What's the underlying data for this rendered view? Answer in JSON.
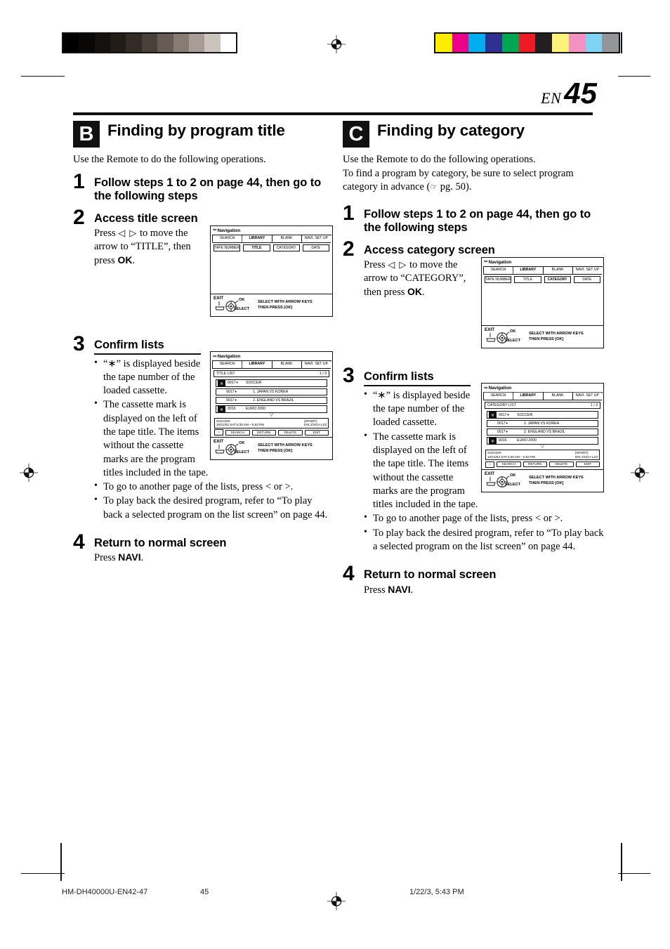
{
  "page": {
    "locale_label": "EN",
    "number": "45"
  },
  "printer_marks": {
    "grayscale_steps": [
      "#000000",
      "#090807",
      "#15110f",
      "#221c18",
      "#332b25",
      "#4a403a",
      "#675c55",
      "#877c74",
      "#a79d96",
      "#cbc4bd",
      "#ffffff"
    ],
    "color_steps": [
      "#fdee00",
      "#ec008c",
      "#00aeef",
      "#2e3192",
      "#00a651",
      "#ed1c24",
      "#231f20",
      "#fff27a",
      "#f491c3",
      "#7fd4f4",
      "#939598"
    ]
  },
  "sections": [
    {
      "badge": "B",
      "title": "Finding by program title",
      "lead": "Use the Remote to do the following operations.",
      "lead2": "",
      "steps": [
        {
          "number": "1",
          "title": "Follow steps 1 to 2 on page 44, then go to the following steps",
          "text": ""
        },
        {
          "number": "2",
          "title": "Access title screen",
          "text_pre": "Press ",
          "arrows": "◁ ▷",
          "text_mid": " to move the arrow to “TITLE”, then press ",
          "bold": "OK",
          "text_post": "."
        },
        {
          "number": "3",
          "title": "Confirm lists",
          "bullets": [
            "“∗” is displayed beside the tape number of the loaded cassette.",
            "The cassette mark is displayed on the left of the tape title. The items without the cassette marks are the program titles included in the tape.",
            "To go to another page of the lists, press < or >.",
            "To play back the desired program, refer to “To play back a selected program on the list screen” on page 44."
          ]
        },
        {
          "number": "4",
          "title": "Return to normal screen",
          "text_pre": "Press ",
          "bold": "NAVI",
          "text_post": "."
        }
      ]
    },
    {
      "badge": "C",
      "title": "Finding by category",
      "lead": "Use the Remote to do the following operations.",
      "lead2_pre": "To find a program by category, be sure to select program category in advance (",
      "lead2_hand": "☞",
      "lead2_post": " pg. 50).",
      "steps": [
        {
          "number": "1",
          "title": "Follow steps 1 to 2 on page 44, then go to the following steps",
          "text": ""
        },
        {
          "number": "2",
          "title": "Access category screen",
          "text_pre": "Press ",
          "arrows": "◁ ▷",
          "text_mid": " to move the arrow to “CATEGORY”, then press ",
          "bold": "OK",
          "text_post": "."
        },
        {
          "number": "3",
          "title": "Confirm lists",
          "bullets": [
            "“∗” is displayed beside the tape number of the loaded cassette.",
            "The cassette mark is displayed on the left of the tape title. The items without the cassette marks are the program titles included in the tape.",
            "To go to another page of the lists, press < or >.",
            "To play back the desired program, refer to “To play back a selected program on the list screen” on page 44."
          ]
        },
        {
          "number": "4",
          "title": "Return to normal screen",
          "text_pre": "Press ",
          "bold": "NAVI",
          "text_post": "."
        }
      ]
    }
  ],
  "osd": {
    "navi_label": "Navigation",
    "tabs": [
      "SEARCH",
      "LIBRARY",
      "BLANK",
      "NAVI. SET UP"
    ],
    "selected_tab": "LIBRARY",
    "fields": [
      "TAPE NUMBER",
      "TITLE",
      "CATEGORY",
      "DATE"
    ],
    "footer_exit": "EXIT",
    "footer_ok": "OK",
    "footer_select": "SELECT",
    "footer_msg_line1": "SELECT WITH ARROW KEYS",
    "footer_msg_line2": "THEN PRESS [OK]",
    "list_page": "1 / 3",
    "rows": [
      {
        "mark": "■",
        "num": "0017∗",
        "title": "SOCCER",
        "indent": false,
        "strong": true
      },
      {
        "mark": "",
        "num": "0017∗",
        "title": "1. JAPAN VS KOREA",
        "indent": true,
        "strong": false
      },
      {
        "mark": "",
        "num": "0017∗",
        "title": "2. ENGLAND VS BRAZIL",
        "indent": true,
        "strong": true
      },
      {
        "mark": "■",
        "num": "0016",
        "title": "EURO 2000",
        "indent": false,
        "strong": true
      }
    ],
    "chevron": "▽",
    "info_title": "SOCCER",
    "info_time": "10/21/02 SAT   6:30 AM – 5:53 PM",
    "info_cat": "[SPORT]",
    "info_sub": "DIS 2/SCH     LS3",
    "buttons": [
      "SEARCH",
      "RETURN",
      "DELETE",
      "EDIT"
    ],
    "button_icon": "⌂",
    "title_list_label": "TITLE LIST",
    "category_list_label": "CATEGORY LIST"
  },
  "footer": {
    "doc_id": "HM-DH40000U-EN42-47",
    "page": "45",
    "timestamp": "1/22/3, 5:43 PM"
  }
}
